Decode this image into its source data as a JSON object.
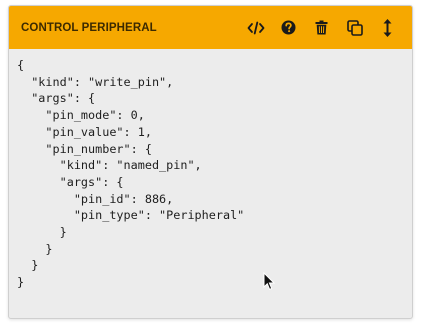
{
  "header": {
    "title": "CONTROL PERIPHERAL",
    "background": "#f6a800",
    "icons": [
      "code-icon",
      "help-icon",
      "trash-icon",
      "duplicate-icon",
      "drag-handle-icon"
    ]
  },
  "code": {
    "text": "{\n  \"kind\": \"write_pin\",\n  \"args\": {\n    \"pin_mode\": 0,\n    \"pin_value\": 1,\n    \"pin_number\": {\n      \"kind\": \"named_pin\",\n      \"args\": {\n        \"pin_id\": 886,\n        \"pin_type\": \"Peripheral\"\n      }\n    }\n  }\n}"
  }
}
